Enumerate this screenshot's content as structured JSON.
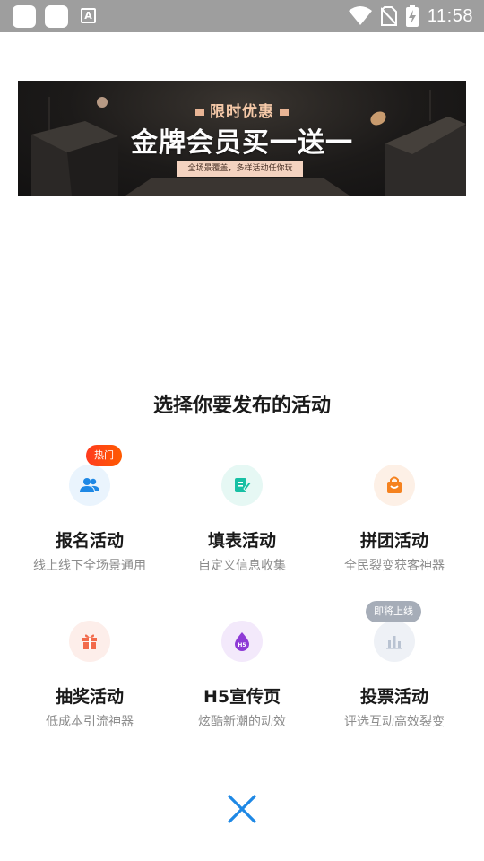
{
  "status_bar": {
    "time": "11:58",
    "icons": [
      "app-placeholder-icon",
      "app-placeholder-icon",
      "font-a-icon",
      "wifi-icon",
      "no-sim-icon",
      "battery-charging-icon"
    ]
  },
  "banner": {
    "tag": "限时优惠",
    "title": "金牌会员买一送一",
    "subtitle": "全场景覆盖，多样活动任你玩"
  },
  "heading": "选择你要发布的活动",
  "activities": [
    {
      "title": "报名活动",
      "desc": "线上线下全场景通用",
      "icon": "users-icon",
      "badge": "热门",
      "icon_color": "#1e88e5",
      "bg_color": "#eaf4fd"
    },
    {
      "title": "填表活动",
      "desc": "自定义信息收集",
      "icon": "form-edit-icon",
      "badge": "",
      "icon_color": "#17c0a4",
      "bg_color": "#e6f8f4"
    },
    {
      "title": "拼团活动",
      "desc": "全民裂变获客神器",
      "icon": "shopping-bag-icon",
      "badge": "",
      "icon_color": "#f5821f",
      "bg_color": "#fdf0e6"
    },
    {
      "title": "抽奖活动",
      "desc": "低成本引流神器",
      "icon": "gift-icon",
      "badge": "",
      "icon_color": "#f26a4b",
      "bg_color": "#fdeeea"
    },
    {
      "title": "H5宣传页",
      "desc": "炫酷新潮的动效",
      "icon": "h5-drop-icon",
      "badge": "",
      "icon_color": "#8e3bd6",
      "bg_color": "#f3e9fb"
    },
    {
      "title": "投票活动",
      "desc": "评选互动高效裂变",
      "icon": "bar-chart-icon",
      "badge": "即将上线",
      "icon_color": "#b9c3d2",
      "bg_color": "#eef1f6"
    }
  ],
  "close_icon": "close-icon"
}
